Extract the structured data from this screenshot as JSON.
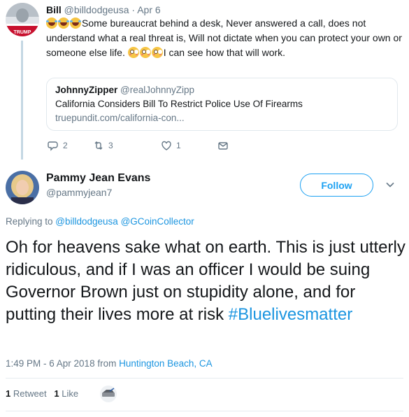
{
  "parent_tweet": {
    "name": "Bill",
    "handle": "@billdodgeusa",
    "sep": "·",
    "date": "Apr 6",
    "avatar_icon": "trump-avatar-icon",
    "avatar_badge": "TRUMP",
    "text_part1": "Some bureaucrat behind a desk, Never answered a call, does not understand what a real threat is, Will not dictate when you can protect your own or someone else life. ",
    "text_part2": "I can see how that will work.",
    "quote": {
      "name": "JohnnyZipper",
      "handle": "@realJohnnyZipp",
      "title": "California Considers Bill To Restrict Police Use Of Firearms",
      "url": "truepundit.com/california-con..."
    },
    "actions": {
      "replies": "2",
      "retweets": "3",
      "likes": "1"
    }
  },
  "main_tweet": {
    "name": "Pammy Jean Evans",
    "handle": "@pammyjean7",
    "follow_label": "Follow",
    "replying_prefix": "Replying to ",
    "replying_mentions": "@billdodgeusa @GCoinCollector",
    "text": "Oh for heavens sake what on earth. This is just utterly ridiculous, and if I was an officer I would be suing Governor Brown just on stupidity alone, and for putting their lives more at risk ",
    "hashtag": "#Bluelivesmatter",
    "time": "1:49 PM - 6 Apr 2018 from ",
    "location": "Huntington Beach, CA",
    "retweet_count": "1",
    "retweet_label": "Retweet",
    "like_count": "1",
    "like_label": "Like"
  },
  "colors": {
    "accent": "#1da1f2",
    "link": "#1b95e0",
    "muted": "#657786",
    "thread_line": "#c4d7e3"
  }
}
